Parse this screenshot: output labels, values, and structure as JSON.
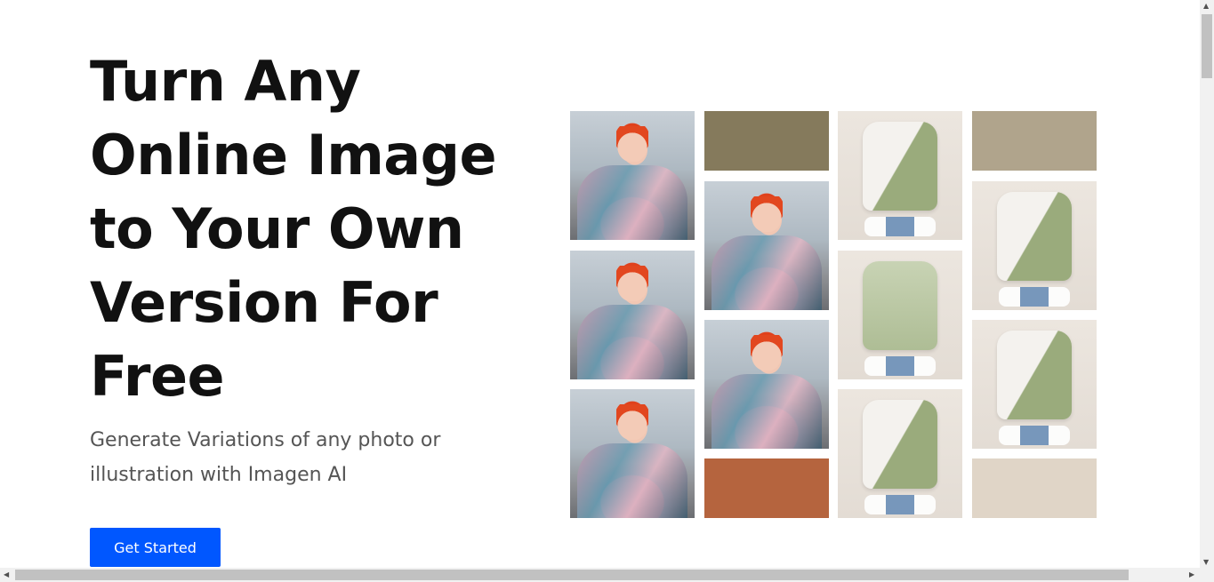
{
  "hero": {
    "title": "Turn Any Online Image to Your Own Version For Free",
    "subtitle": "Generate Variations of any photo or illustration with Imagen AI",
    "cta_label": "Get Started"
  },
  "colors": {
    "cta_background": "#0057ff",
    "swatch_olive_brown": "#857a5c",
    "swatch_taupe": "#b0a48c",
    "swatch_rust": "#b5643e",
    "swatch_beige": "#e0d5c7"
  },
  "scrollbars": {
    "up_arrow": "▲",
    "down_arrow": "▼",
    "left_arrow": "◀",
    "right_arrow": "▶"
  }
}
